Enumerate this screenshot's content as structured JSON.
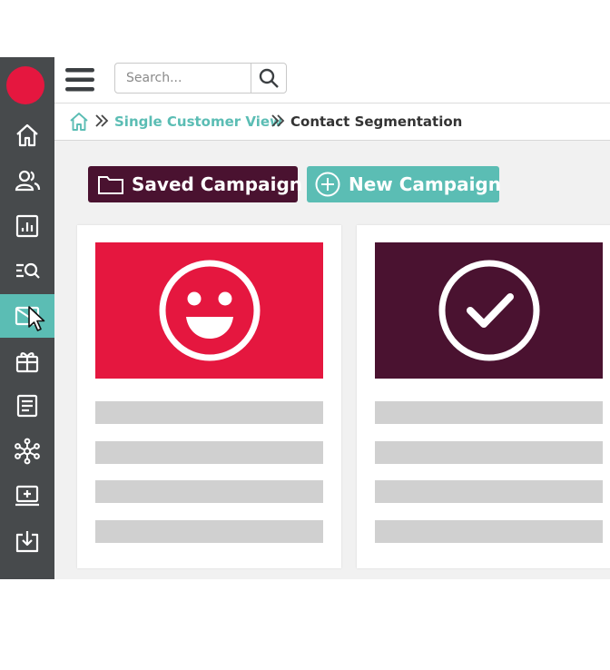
{
  "colors": {
    "sidebar_bg": "#474a4c",
    "accent_teal": "#5bbdb4",
    "brand_red": "#e5173f",
    "brand_plum": "#4a1230",
    "placeholder_bar": "#d0d0d0"
  },
  "sidebar": {
    "logo": "red-circle-logo",
    "items": [
      {
        "icon": "home-icon"
      },
      {
        "icon": "users-icon"
      },
      {
        "icon": "bar-chart-icon"
      },
      {
        "icon": "list-search-icon"
      },
      {
        "icon": "mail-icon",
        "active": true
      },
      {
        "icon": "gift-icon"
      },
      {
        "icon": "document-icon"
      },
      {
        "icon": "network-icon"
      },
      {
        "icon": "monitor-plus-icon"
      },
      {
        "icon": "download-icon"
      }
    ]
  },
  "header": {
    "menu_icon": "hamburger-icon",
    "search": {
      "placeholder": "Search...",
      "value": "",
      "icon": "search-icon"
    }
  },
  "breadcrumb": {
    "home_icon": "home-icon",
    "separator_icon": "double-chevron-right-icon",
    "items": [
      "Single Customer View",
      "Contact Segmentation"
    ]
  },
  "actions": {
    "saved_label": "Saved Campaign",
    "saved_icon": "folder-icon",
    "new_label": "New Campaign",
    "new_icon": "plus-circle-icon"
  },
  "cards": [
    {
      "icon": "smiley-face-icon",
      "banner_color": "#e5173f",
      "placeholder_lines": 4
    },
    {
      "icon": "checkmark-circle-icon",
      "banner_color": "#4a1230",
      "placeholder_lines": 4
    }
  ]
}
